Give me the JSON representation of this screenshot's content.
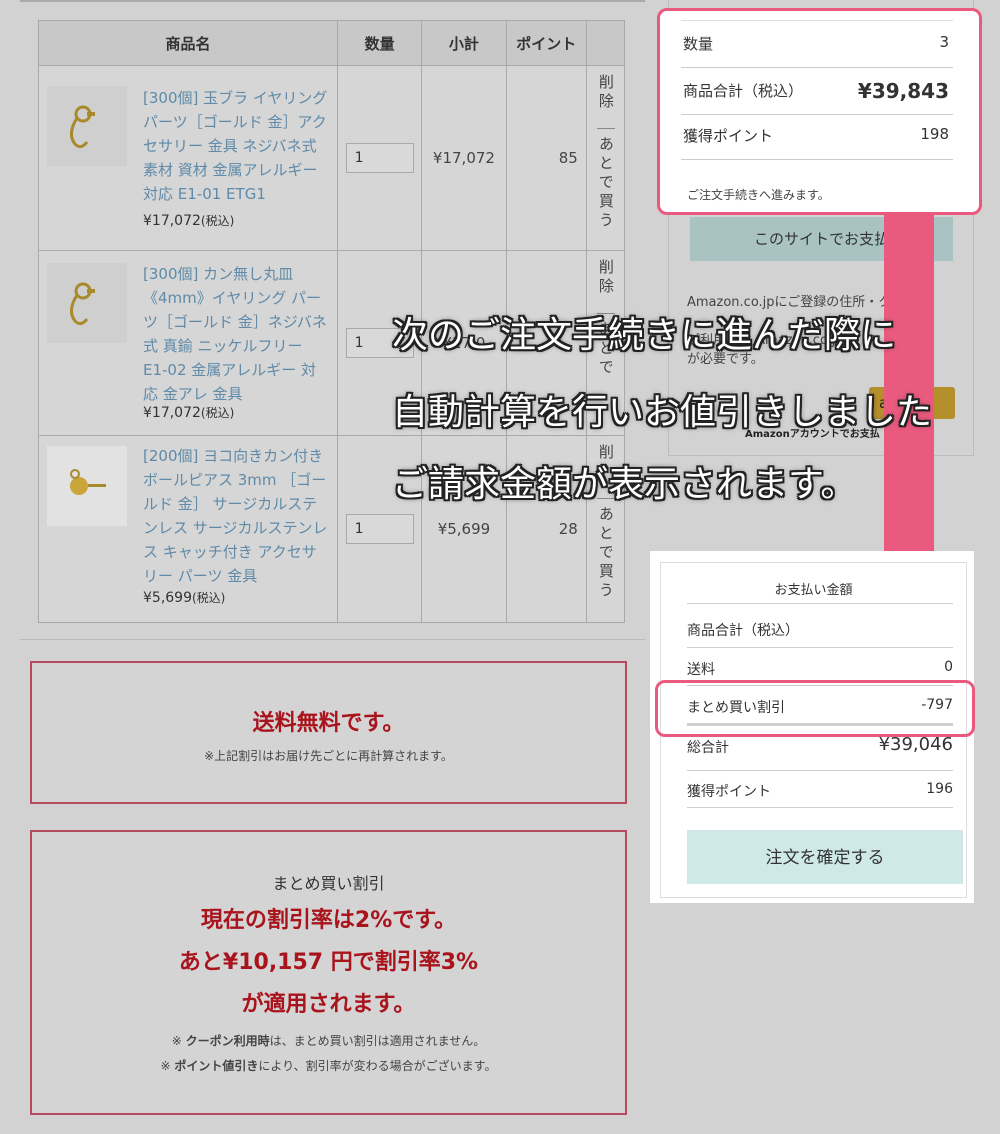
{
  "cart": {
    "headers": {
      "name": "商品名",
      "qty": "数量",
      "subtotal": "小計",
      "points": "ポイント"
    },
    "items": [
      {
        "name": "[300個] 玉ブラ イヤリングパーツ［ゴールド 金］アクセサリー 金具 ネジバネ式 素材 資材 金属アレルギー対応 E1-01 ETG1",
        "unit_price": "¥17,072",
        "tax_label": "(税込)",
        "qty": "1",
        "subtotal": "¥17,072",
        "points": "85",
        "delete": "削除",
        "later": "あとで買う"
      },
      {
        "name": "[300個] カン無し丸皿 《4mm》イヤリング パーツ［ゴールド 金］ネジバネ式 真鍮 ニッケルフリー E1-02 金属アレルギー 対応 金アレ 金具",
        "unit_price": "¥17,072",
        "tax_label": "(税込)",
        "qty": "1",
        "subtotal": "¥17,0",
        "points": "",
        "delete": "削除",
        "later": "あとで"
      },
      {
        "name": "[200個] ヨコ向きカン付き ボールピアス 3mm ［ゴールド 金］ サージカルステンレス サージカルステンレス キャッチ付き アクセサリー パーツ 金具",
        "unit_price": "¥5,699",
        "tax_label": "(税込)",
        "qty": "1",
        "subtotal": "¥5,699",
        "points": "28",
        "delete": "削",
        "later": "あとで買う"
      }
    ]
  },
  "promo_shipping": {
    "title": "送料無料です。",
    "note": "※上記割引はお届け先ごとに再計算されます。"
  },
  "promo_bulk": {
    "label": "まとめ買い割引",
    "line1": "現在の割引率は2%です。",
    "line2": "あと¥10,157 円で割引率3%",
    "line3": "が適用されます。",
    "note1_bold": "クーポン利用時",
    "note1": "は、まとめ買い割引は適用されません。",
    "note2_bold": "ポイント値引き",
    "note2": "により、割引率が変わる場合がございます。"
  },
  "summary": {
    "qty_label": "数量",
    "qty_value": "3",
    "total_label": "商品合計（税込）",
    "total_value": "¥39,843",
    "points_label": "獲得ポイント",
    "points_value": "198",
    "proceed_text": "ご注文手続きへ進みます。"
  },
  "amazon": {
    "site_pay_button": "このサイトでお支払",
    "notice": "Amazon.co.jpにご登録の住所・クレジット情報を利用してご注文いただけます。ご利用にはAmazon.co.jpアカウントが必要です。",
    "notice_l1": "Amazon.co.jpにご登録の住所・ク",
    "notice_l2": "ご利用には Amazon.co.jp ア",
    "notice_l3": "が必要です。",
    "pay_button": "ay",
    "account_caption": "Amazonアカウントでお支払"
  },
  "caption": {
    "line1": "次のご注文手続きに進んだ際に",
    "line2": "自動計算を行いお値引きしました",
    "line3": "ご請求金額が表示されます。"
  },
  "payment": {
    "title": "お支払い金額",
    "subtotal_label": "商品合計（税込）",
    "shipping_label": "送料",
    "shipping_value": "0",
    "discount_label": "まとめ買い割引",
    "discount_value": "-797",
    "total_label": "総合計",
    "total_value": "¥39,046",
    "points_label": "獲得ポイント",
    "points_value": "196",
    "confirm_button": "注文を確定する"
  },
  "colors": {
    "highlight": "#ea5a7f",
    "promo_red": "#a8131c",
    "link_blue": "#5f8aa8",
    "confirm_bg": "#cfe8e8"
  }
}
